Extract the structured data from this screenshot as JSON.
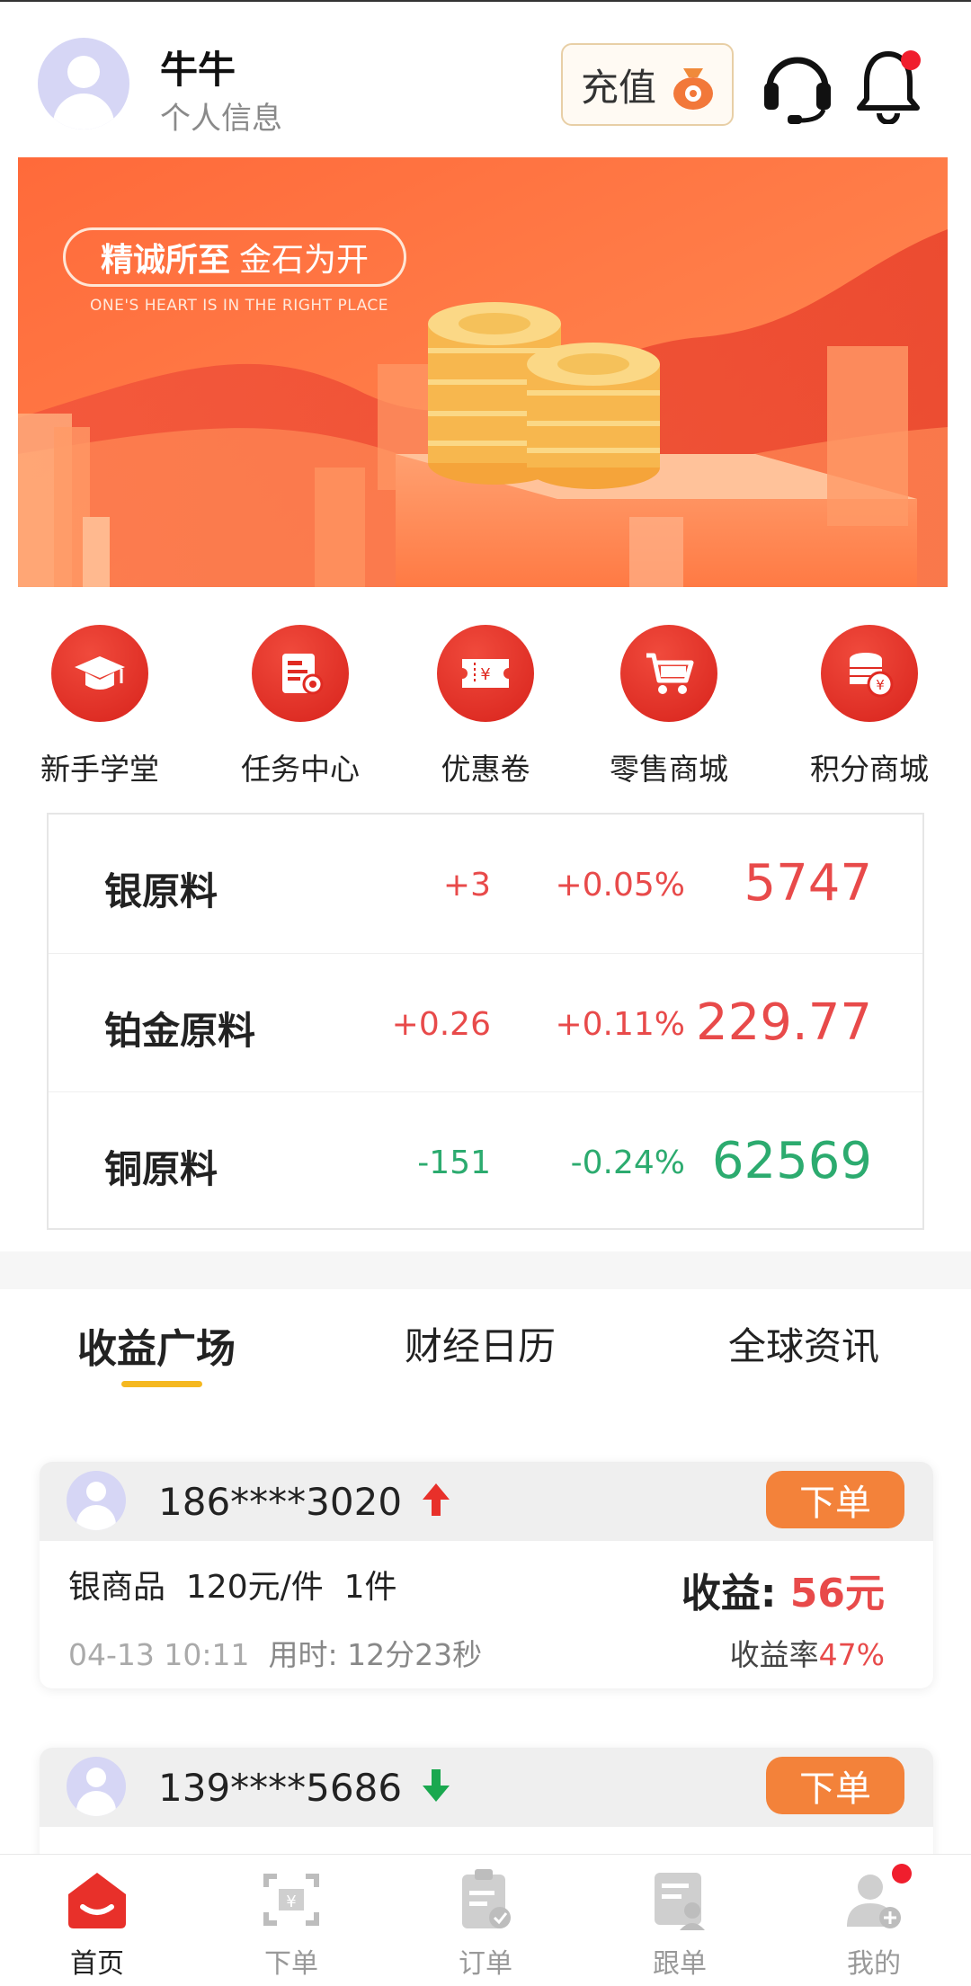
{
  "header": {
    "user_name": "牛牛",
    "user_subtitle": "个人信息",
    "recharge_label": "充值",
    "icons": [
      "avatar",
      "money-bag-icon",
      "headset-icon",
      "bell-icon"
    ],
    "notification_dot": true
  },
  "banner": {
    "tag_bold": "精诚所至",
    "tag_light": "金石为开",
    "subtitle": "ONE'S HEART IS IN THE RIGHT PLACE"
  },
  "menu": [
    {
      "label": "新手学堂",
      "icon": "graduation-cap-icon"
    },
    {
      "label": "任务中心",
      "icon": "task-document-icon"
    },
    {
      "label": "优惠卷",
      "icon": "coupon-icon"
    },
    {
      "label": "零售商城",
      "icon": "shopping-cart-icon"
    },
    {
      "label": "积分商城",
      "icon": "coin-stack-icon"
    }
  ],
  "prices": [
    {
      "name": "银原料",
      "change": "+3",
      "percent": "+0.05%",
      "value": "5747",
      "trend": "up"
    },
    {
      "name": "铂金原料",
      "change": "+0.26",
      "percent": "+0.11%",
      "value": "229.77",
      "trend": "up"
    },
    {
      "name": "铜原料",
      "change": "-151",
      "percent": "-0.24%",
      "value": "62569",
      "trend": "down"
    }
  ],
  "tabs": [
    {
      "label": "收益广场",
      "active": true
    },
    {
      "label": "财经日历",
      "active": false
    },
    {
      "label": "全球资讯",
      "active": false
    }
  ],
  "cards": [
    {
      "phone": "186****3020",
      "direction": "up",
      "order_label": "下单",
      "product": "银商品  120元/件  1件",
      "profit_label": "收益:",
      "profit_amount": "56元",
      "time": "04-13 10:11",
      "used_label": "用时:",
      "used_value": "12分23秒",
      "rate_label": "收益率",
      "rate_value": "47%"
    },
    {
      "phone": "139****5686",
      "direction": "down",
      "order_label": "下单"
    }
  ],
  "bottom_nav": [
    {
      "label": "首页",
      "icon": "home-icon",
      "active": true
    },
    {
      "label": "下单",
      "icon": "order-scan-icon",
      "active": false
    },
    {
      "label": "订单",
      "icon": "clipboard-icon",
      "active": false
    },
    {
      "label": "跟单",
      "icon": "follow-order-icon",
      "active": false
    },
    {
      "label": "我的",
      "icon": "profile-icon",
      "active": false,
      "badge": true
    }
  ],
  "colors": {
    "accent_red": "#e84a4a",
    "accent_green": "#2cab6f",
    "order_button": "#f3823a",
    "tab_underline": "#f5b820",
    "menu_icon": "#e02a22"
  }
}
